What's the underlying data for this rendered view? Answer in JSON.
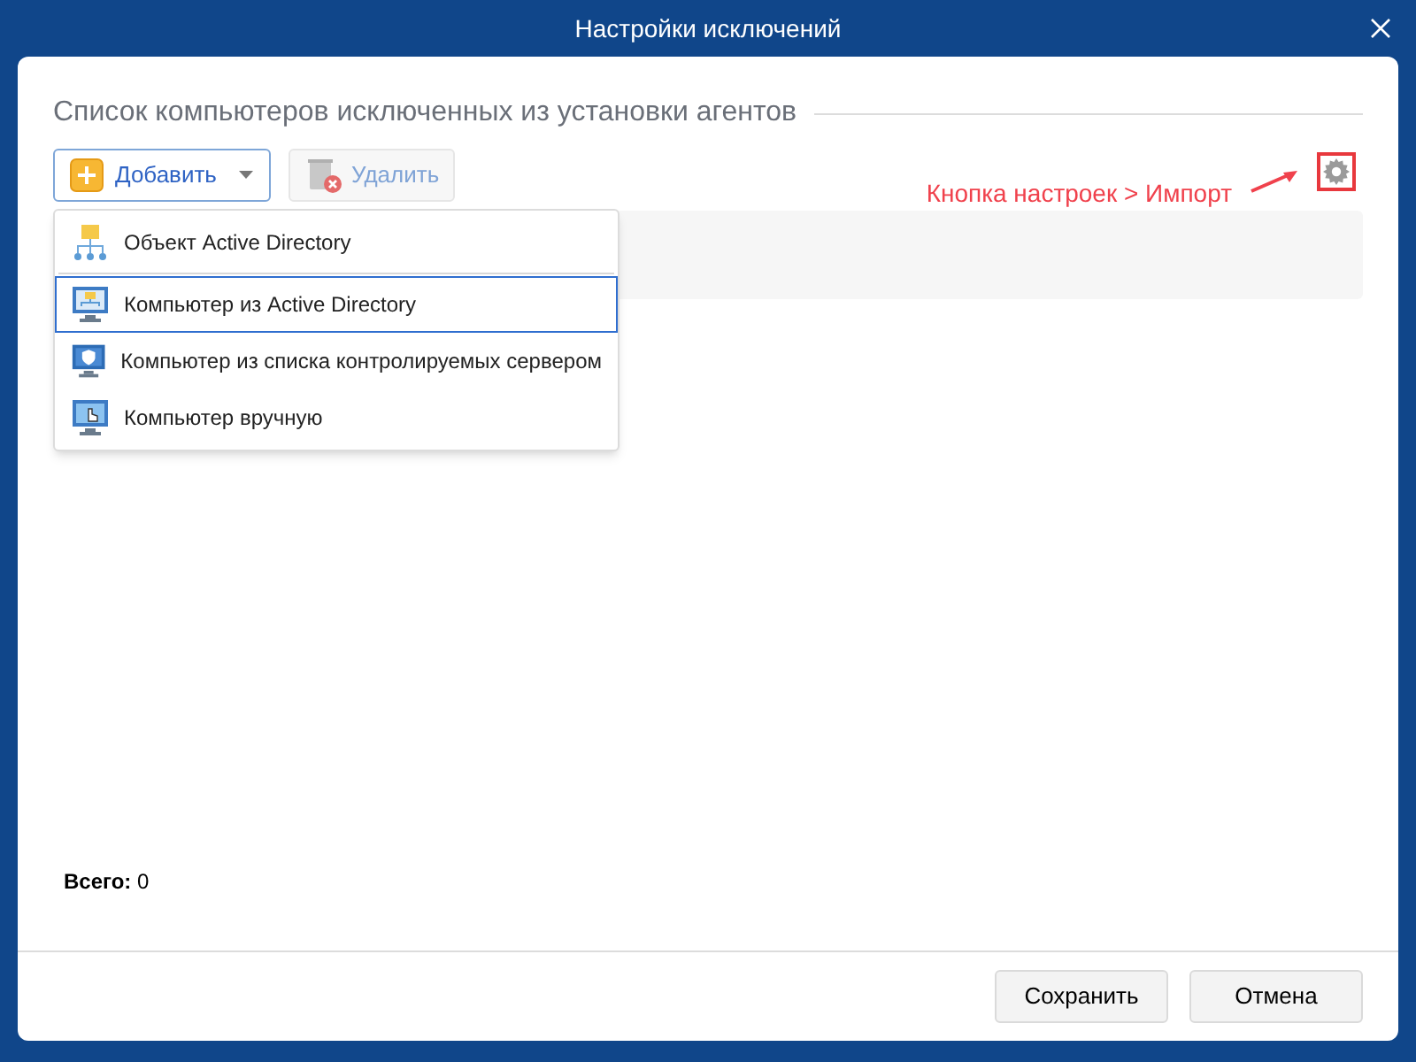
{
  "window": {
    "title": "Настройки исключений"
  },
  "section_title": "Список компьютеров исключенных из установки агентов",
  "toolbar": {
    "add_button": "Добавить",
    "delete_button": {
      "label": "Удалить",
      "disabled": true
    }
  },
  "annotation": "Кнопка настроек > Импорт",
  "add_menu": [
    {
      "label": "Объект Active Directory",
      "kind": "ad-object",
      "selected": false
    },
    {
      "label": "Компьютер из Active Directory",
      "kind": "ad-computer",
      "selected": true
    },
    {
      "label": "Компьютер из списка контролируемых сервером",
      "kind": "server-computer",
      "selected": false
    },
    {
      "label": "Компьютер вручную",
      "kind": "manual-computer",
      "selected": false
    }
  ],
  "total": "**Всего:** 0",
  "buttons": [
    "Сохранить",
    "Отмена"
  ]
}
